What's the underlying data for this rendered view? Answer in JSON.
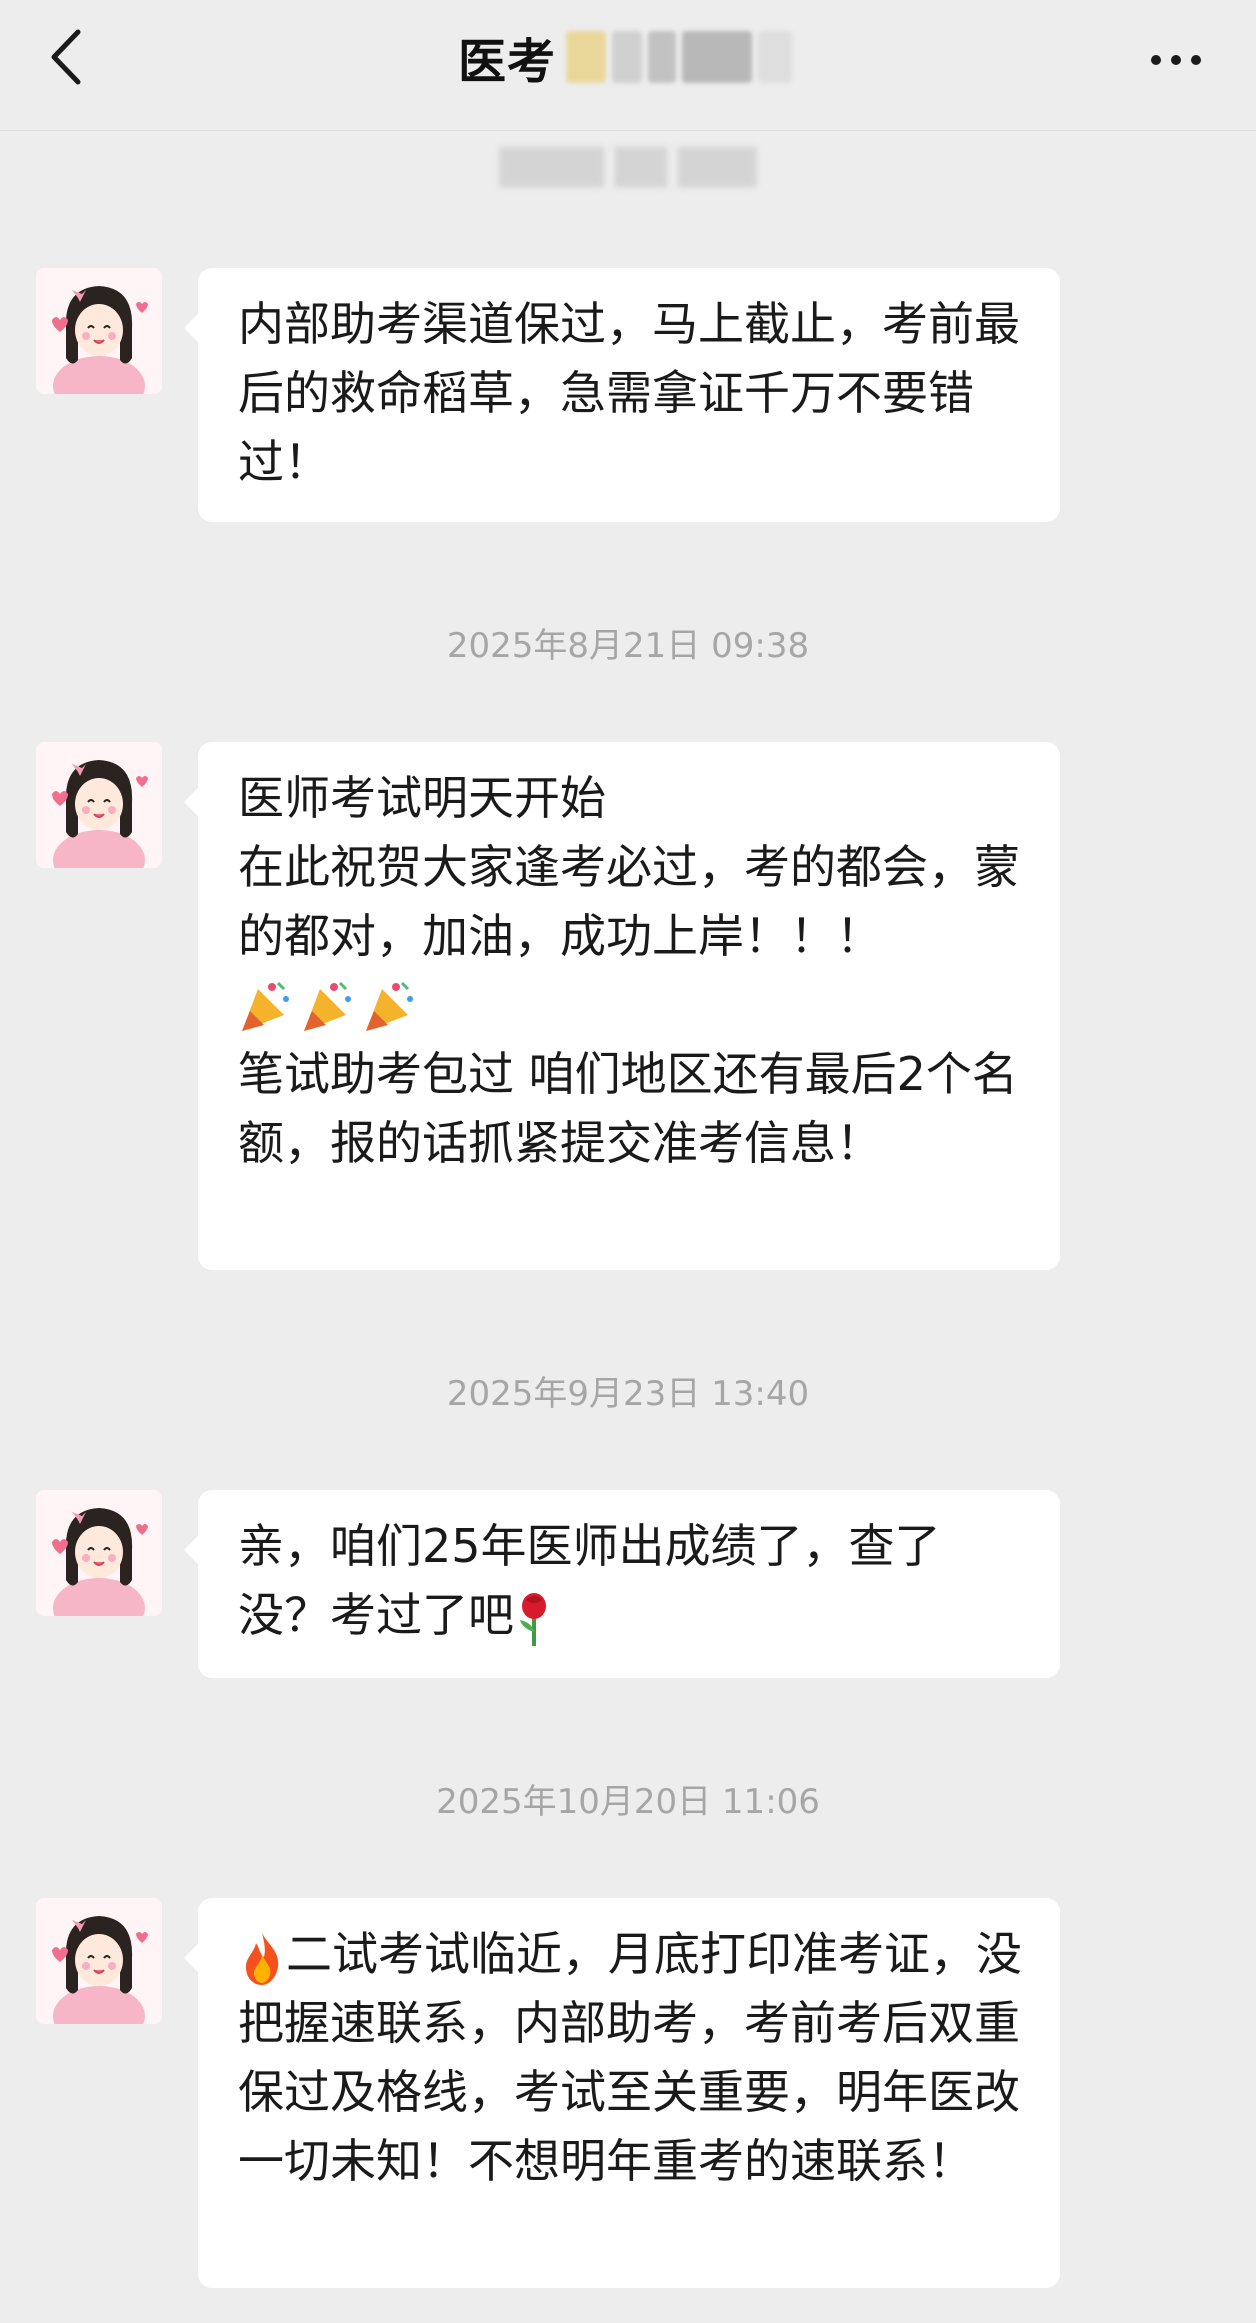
{
  "header": {
    "title": "医考",
    "back_icon": "chevron-left-icon",
    "more_icon": "more-horizontal-icon"
  },
  "messages": [
    {
      "text": "内部助考渠道保过，马上截止，考前最后的救命稻草，急需拿证千万不要错过！"
    },
    {
      "timestamp": "2025年8月21日 09:38",
      "text_a": "医师考试明天开始\n在此祝贺大家逢考必过，考的都会，蒙的都对，加油，成功上岸！！！",
      "emoji": "party-popper-icon",
      "text_b": "笔试助考包过 咱们地区还有最后2个名额，报的话抓紧提交准考信息！"
    },
    {
      "timestamp": "2025年9月23日 13:40",
      "text": "亲，咱们25年医师出成绩了，查了没？考过了吧",
      "emoji": "rose-icon"
    },
    {
      "timestamp": "2025年10月20日 11:06",
      "emoji": "fire-icon",
      "text": "二试考试临近，月底打印准考证，没把握速联系，内部助考，考前考后双重保过及格线，考试至关重要，明年医改一切未知！不想明年重考的速联系！"
    }
  ],
  "colors": {
    "background": "#ededed",
    "bubble": "#ffffff",
    "timestamp": "#a6a6a6"
  }
}
